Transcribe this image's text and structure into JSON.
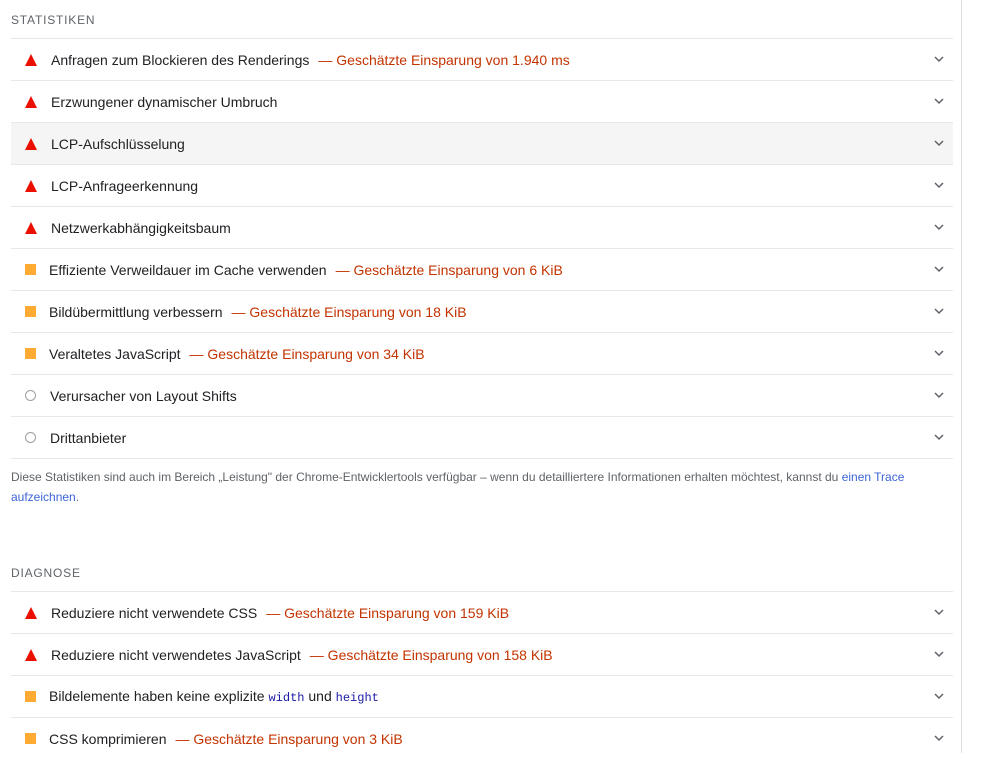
{
  "statistiken": {
    "header": "STATISTIKEN",
    "items": [
      {
        "status": "fail",
        "title": "Anfragen zum Blockieren des Renderings",
        "savings": "— Geschätzte Einsparung von 1.940 ms"
      },
      {
        "status": "fail",
        "title": "Erzwungener dynamischer Umbruch",
        "savings": ""
      },
      {
        "status": "fail",
        "title": "LCP-Aufschlüsselung",
        "savings": ""
      },
      {
        "status": "fail",
        "title": "LCP-Anfrageerkennung",
        "savings": ""
      },
      {
        "status": "fail",
        "title": "Netzwerkabhängigkeitsbaum",
        "savings": ""
      },
      {
        "status": "average",
        "title": "Effiziente Verweildauer im Cache verwenden",
        "savings": "— Geschätzte Einsparung von 6 KiB"
      },
      {
        "status": "average",
        "title": "Bildübermittlung verbessern",
        "savings": "— Geschätzte Einsparung von 18 KiB"
      },
      {
        "status": "average",
        "title": "Veraltetes JavaScript",
        "savings": "— Geschätzte Einsparung von 34 KiB"
      },
      {
        "status": "info",
        "title": "Verursacher von Layout Shifts",
        "savings": ""
      },
      {
        "status": "info",
        "title": "Drittanbieter",
        "savings": ""
      }
    ],
    "note_text": "Diese Statistiken sind auch im Bereich „Leistung\" der Chrome-Entwicklertools verfügbar – wenn du detailliertere Informationen erhalten möchtest, kannst du ",
    "note_link": "einen Trace aufzeichnen",
    "note_end": "."
  },
  "diagnose": {
    "header": "DIAGNOSE",
    "items": [
      {
        "status": "fail",
        "title": "Reduziere nicht verwendete CSS",
        "savings": "— Geschätzte Einsparung von 159 KiB"
      },
      {
        "status": "fail",
        "title": "Reduziere nicht verwendetes JavaScript",
        "savings": "— Geschätzte Einsparung von 158 KiB"
      },
      {
        "status": "average",
        "title_part1": "Bildelemente haben keine explizite ",
        "code1": "width",
        "title_part2": " und ",
        "code2": "height"
      },
      {
        "status": "average",
        "title": "CSS komprimieren",
        "savings": "— Geschätzte Einsparung von 3 KiB"
      }
    ]
  },
  "colors": {
    "fail": "#eb0f00",
    "average": "#ffaa33",
    "savings": "#c33300",
    "link": "#3b63d7"
  },
  "icons": {
    "fail": "red-triangle-icon",
    "average": "orange-square-icon",
    "info": "gray-circle-icon",
    "expand": "chevron-down-icon"
  }
}
